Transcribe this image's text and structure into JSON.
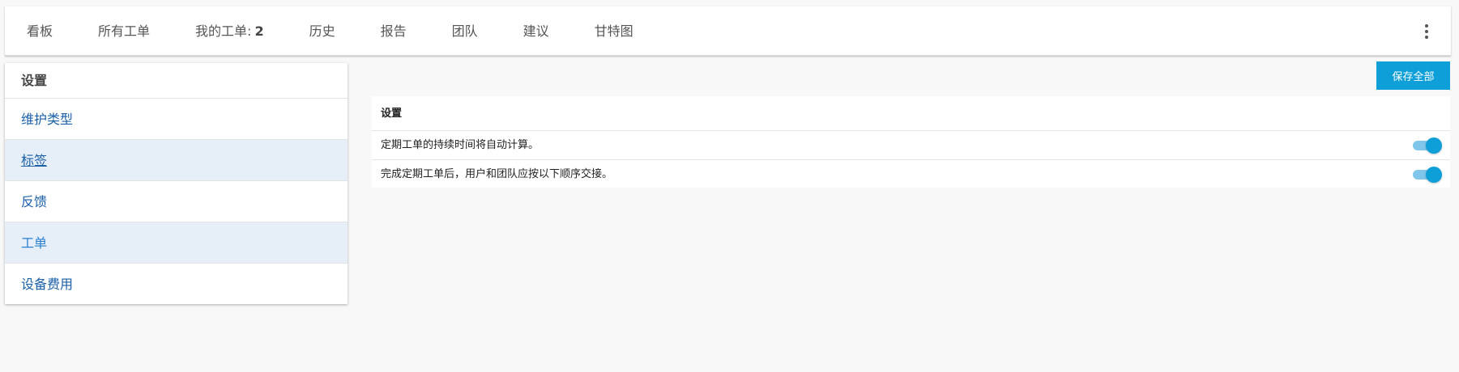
{
  "topnav": {
    "items": [
      {
        "label": "看板"
      },
      {
        "label": "所有工单"
      },
      {
        "label": "我的工单:",
        "count": "2"
      },
      {
        "label": "历史"
      },
      {
        "label": "报告"
      },
      {
        "label": "团队"
      },
      {
        "label": "建议"
      },
      {
        "label": "甘特图"
      }
    ],
    "more_icon": "kebab-vertical-icon"
  },
  "sidebar": {
    "title": "设置",
    "items": [
      {
        "label": "维护类型"
      },
      {
        "label": "标签",
        "state": "hovered"
      },
      {
        "label": "反馈"
      },
      {
        "label": "工单",
        "state": "selected"
      },
      {
        "label": "设备费用"
      }
    ]
  },
  "toolbar": {
    "save_all_label": "保存全部"
  },
  "settings_panel": {
    "header": "设置",
    "rows": [
      {
        "label": "定期工单的持续时间将自动计算。",
        "enabled": true
      },
      {
        "label": "完成定期工单后，用户和团队应按以下顺序交接。",
        "enabled": true
      }
    ]
  },
  "colors": {
    "accent": "#0e9fd8",
    "link": "#1a5fa8",
    "selected_bg": "#e6eef8",
    "toggle_track": "#7fc6ea"
  }
}
